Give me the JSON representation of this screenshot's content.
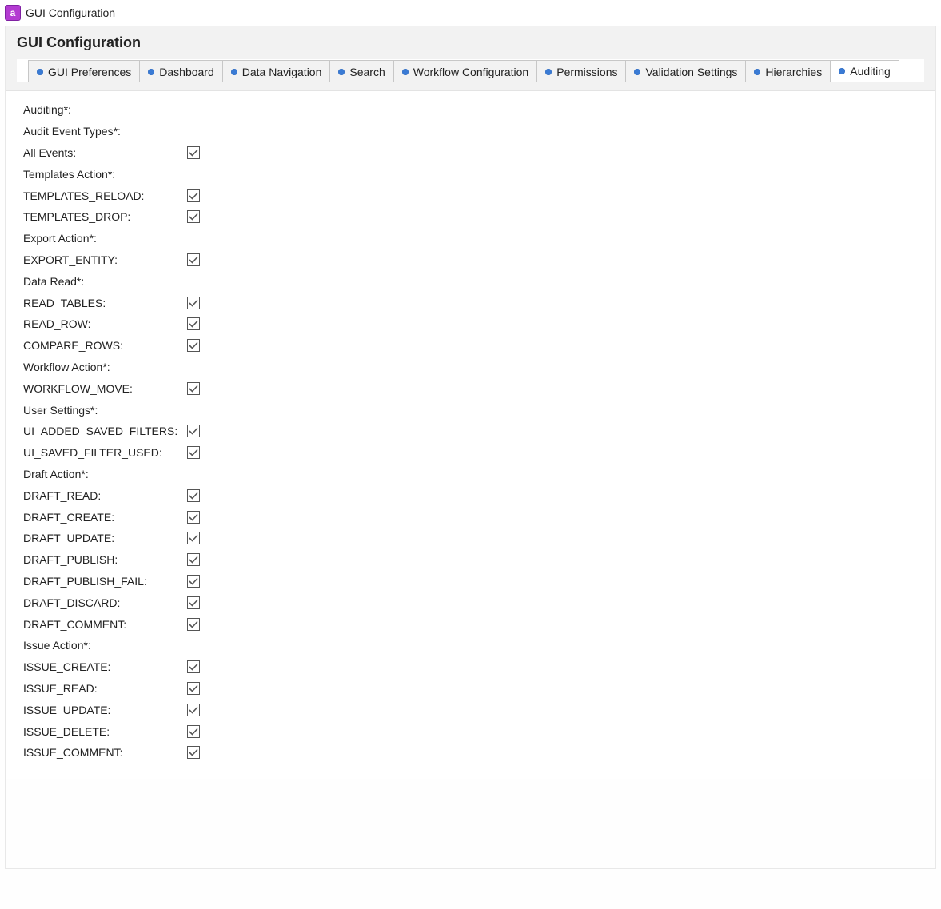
{
  "window": {
    "title": "GUI Configuration"
  },
  "header": {
    "title": "GUI Configuration"
  },
  "tabs": [
    {
      "label": "GUI Preferences",
      "active": false
    },
    {
      "label": "Dashboard",
      "active": false
    },
    {
      "label": "Data Navigation",
      "active": false
    },
    {
      "label": "Search",
      "active": false
    },
    {
      "label": "Workflow Configuration",
      "active": false
    },
    {
      "label": "Permissions",
      "active": false
    },
    {
      "label": "Validation Settings",
      "active": false
    },
    {
      "label": "Hierarchies",
      "active": false
    },
    {
      "label": "Auditing",
      "active": true
    }
  ],
  "form": {
    "rows": [
      {
        "type": "section",
        "label": "Auditing*:"
      },
      {
        "type": "section",
        "label": "Audit Event Types*:"
      },
      {
        "type": "check",
        "label": "All Events:",
        "checked": true,
        "key": "all-events"
      },
      {
        "type": "section",
        "label": "Templates Action*:"
      },
      {
        "type": "check",
        "label": "TEMPLATES_RELOAD:",
        "checked": true,
        "key": "templates-reload"
      },
      {
        "type": "check",
        "label": "TEMPLATES_DROP:",
        "checked": true,
        "key": "templates-drop"
      },
      {
        "type": "section",
        "label": "Export Action*:"
      },
      {
        "type": "check",
        "label": "EXPORT_ENTITY:",
        "checked": true,
        "key": "export-entity"
      },
      {
        "type": "section",
        "label": "Data Read*:"
      },
      {
        "type": "check",
        "label": "READ_TABLES:",
        "checked": true,
        "key": "read-tables"
      },
      {
        "type": "check",
        "label": "READ_ROW:",
        "checked": true,
        "key": "read-row"
      },
      {
        "type": "check",
        "label": "COMPARE_ROWS:",
        "checked": true,
        "key": "compare-rows"
      },
      {
        "type": "section",
        "label": "Workflow Action*:"
      },
      {
        "type": "check",
        "label": "WORKFLOW_MOVE:",
        "checked": true,
        "key": "workflow-move"
      },
      {
        "type": "section",
        "label": "User Settings*:"
      },
      {
        "type": "check",
        "label": "UI_ADDED_SAVED_FILTERS:",
        "checked": true,
        "key": "ui-added-saved-filters"
      },
      {
        "type": "check",
        "label": "UI_SAVED_FILTER_USED:",
        "checked": true,
        "key": "ui-saved-filter-used"
      },
      {
        "type": "section",
        "label": "Draft Action*:"
      },
      {
        "type": "check",
        "label": "DRAFT_READ:",
        "checked": true,
        "key": "draft-read"
      },
      {
        "type": "check",
        "label": "DRAFT_CREATE:",
        "checked": true,
        "key": "draft-create"
      },
      {
        "type": "check",
        "label": "DRAFT_UPDATE:",
        "checked": true,
        "key": "draft-update"
      },
      {
        "type": "check",
        "label": "DRAFT_PUBLISH:",
        "checked": true,
        "key": "draft-publish"
      },
      {
        "type": "check",
        "label": "DRAFT_PUBLISH_FAIL:",
        "checked": true,
        "key": "draft-publish-fail"
      },
      {
        "type": "check",
        "label": "DRAFT_DISCARD:",
        "checked": true,
        "key": "draft-discard"
      },
      {
        "type": "check",
        "label": "DRAFT_COMMENT:",
        "checked": true,
        "key": "draft-comment"
      },
      {
        "type": "section",
        "label": "Issue Action*:"
      },
      {
        "type": "check",
        "label": "ISSUE_CREATE:",
        "checked": true,
        "key": "issue-create"
      },
      {
        "type": "check",
        "label": "ISSUE_READ:",
        "checked": true,
        "key": "issue-read"
      },
      {
        "type": "check",
        "label": "ISSUE_UPDATE:",
        "checked": true,
        "key": "issue-update"
      },
      {
        "type": "check",
        "label": "ISSUE_DELETE:",
        "checked": true,
        "key": "issue-delete"
      },
      {
        "type": "check",
        "label": "ISSUE_COMMENT:",
        "checked": true,
        "key": "issue-comment"
      }
    ]
  }
}
